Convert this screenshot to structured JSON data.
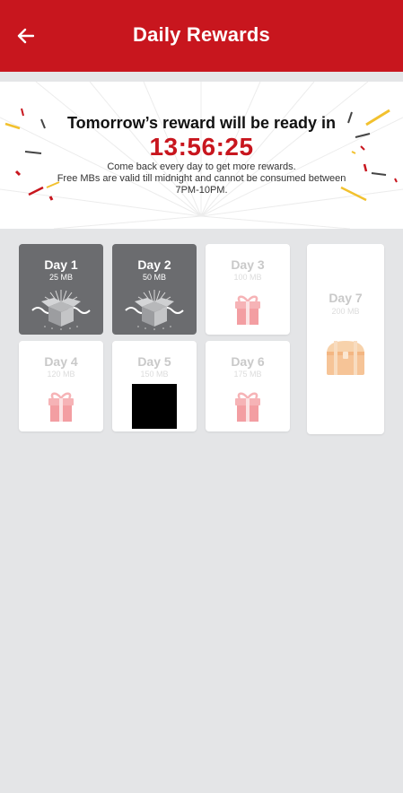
{
  "app_bar": {
    "title": "Daily Rewards"
  },
  "banner": {
    "heading": "Tomorrow’s reward will be ready in",
    "timer": "13:56:25",
    "sub_line1": "Come back every day to get more rewards.",
    "sub_line2": "Free MBs are valid till midnight and cannot be consumed between 7PM-10PM."
  },
  "days": [
    {
      "label": "Day 1",
      "mb": "25 MB",
      "state": "claimed",
      "icon": "open-box-icon"
    },
    {
      "label": "Day 2",
      "mb": "50 MB",
      "state": "claimed",
      "icon": "open-box-icon"
    },
    {
      "label": "Day 3",
      "mb": "100 MB",
      "state": "locked",
      "icon": "gift-icon"
    },
    {
      "label": "Day 4",
      "mb": "120 MB",
      "state": "locked",
      "icon": "gift-icon"
    },
    {
      "label": "Day 5",
      "mb": "150 MB",
      "state": "locked",
      "icon": "gift-icon"
    },
    {
      "label": "Day 6",
      "mb": "175 MB",
      "state": "locked",
      "icon": "gift-icon"
    },
    {
      "label": "Day 7",
      "mb": "200 MB",
      "state": "locked",
      "icon": "treasure-chest-icon"
    }
  ],
  "colors": {
    "brand_red": "#c8161e",
    "claimed_card": "#6b6c6f",
    "background": "#e4e5e7"
  }
}
